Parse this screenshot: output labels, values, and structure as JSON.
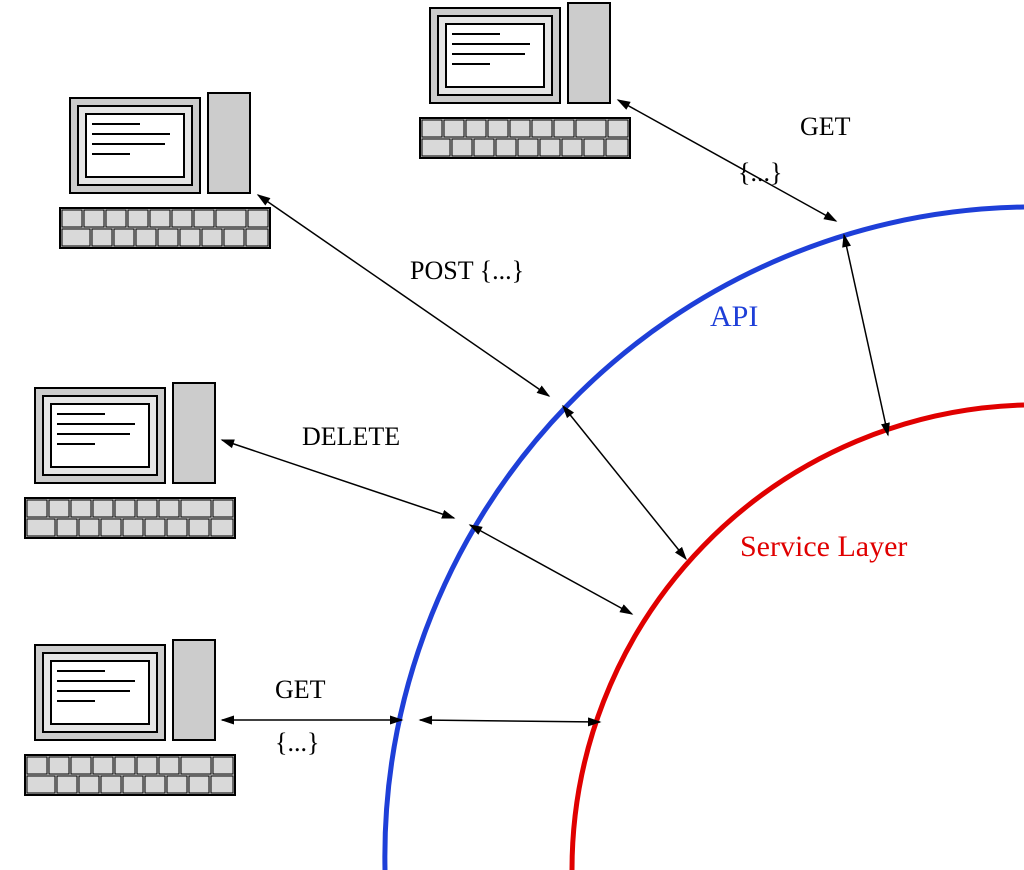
{
  "labels": {
    "api": "API",
    "service": "Service Layer",
    "post": "POST {...}",
    "delete": "DELETE",
    "get3": "GET",
    "get3_body": "{...}",
    "get_top": "GET",
    "get_top_body": "{...}"
  },
  "arcs": {
    "api_color": "#1e3fd8",
    "service_color": "#e00000"
  }
}
